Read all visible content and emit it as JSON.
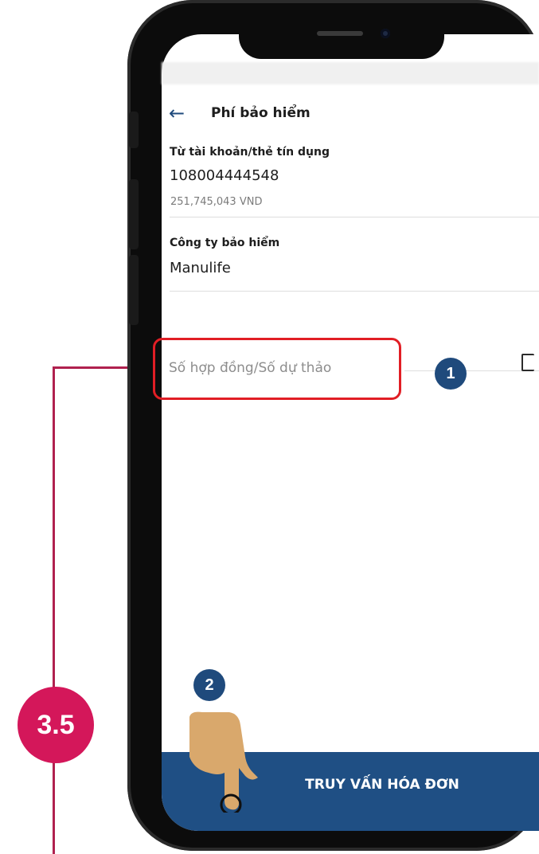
{
  "tutorial": {
    "step_number": "3.5"
  },
  "header": {
    "back_icon": "arrow-left-icon",
    "title": "Phí bảo hiểm"
  },
  "account": {
    "label": "Từ tài khoản/thẻ tín dụng",
    "number": "108004444548",
    "balance": "251,745,043 VND"
  },
  "insurer": {
    "label": "Công ty bảo hiểm",
    "value": "Manulife"
  },
  "contract": {
    "placeholder": "Số hợp đồng/Số dự thảo",
    "marker": "1"
  },
  "action": {
    "marker": "2",
    "label": "TRUY VẤN HÓA ĐƠN"
  },
  "colors": {
    "brand_blue": "#1f4f84",
    "highlight_red": "#e11e25",
    "step_pink": "#d4175a"
  }
}
